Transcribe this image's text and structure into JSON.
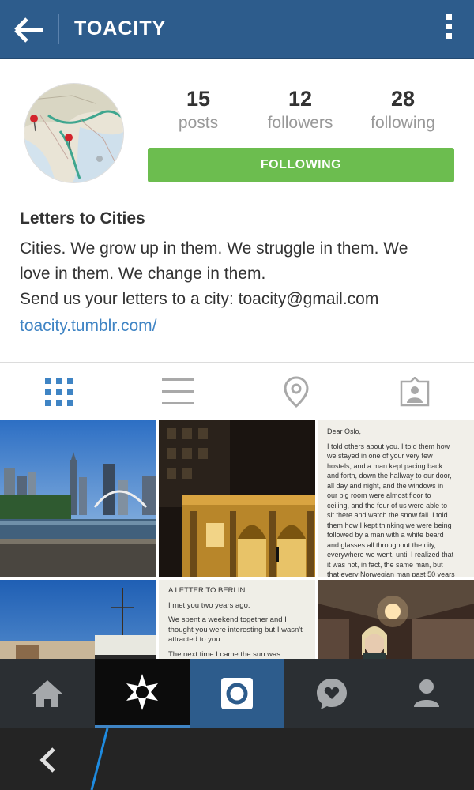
{
  "header": {
    "title": "TOACITY"
  },
  "profile": {
    "stats": [
      {
        "count": "15",
        "label": "posts"
      },
      {
        "count": "12",
        "label": "followers"
      },
      {
        "count": "28",
        "label": "following"
      }
    ],
    "follow_button_label": "FOLLOWING",
    "name": "Letters to Cities",
    "bio_lines": [
      "Cities. We grow up in them. We struggle in them. We",
      "love in them. We change in them.",
      "Send us your letters to a city: toacity@gmail.com"
    ],
    "website": "toacity.tumblr.com/"
  },
  "tabs": [
    {
      "name": "grid-view",
      "icon": "grid-icon",
      "active": true
    },
    {
      "name": "list-view",
      "icon": "list-icon",
      "active": false
    },
    {
      "name": "map-view",
      "icon": "location-pin-icon",
      "active": false
    },
    {
      "name": "tagged-view",
      "icon": "tagged-person-icon",
      "active": false
    }
  ],
  "posts": {
    "letter_oslo": [
      "Dear Oslo,",
      "",
      "I told others about you. I told them how",
      "we stayed in one of your very few",
      "hostels, and a man kept pacing back",
      "and forth, down the hallway to our door,",
      "all day and night, and the windows in",
      "our big room were almost floor to",
      "ceiling, and the four of us were able to",
      "sit there and watch the snow fall. I told",
      "them how I kept thinking we were being",
      "followed by a man with a white beard",
      "and glasses all throughout the city,",
      "everywhere we went, until I realized that",
      "it was not, in fact, the same man, but",
      "that every Norwegian man past 50 years"
    ],
    "letter_berlin": [
      "A LETTER TO BERLIN:",
      "",
      "I met you two years ago.",
      "",
      "We spent a weekend together and I",
      "thought you were interesting but I wasn't",
      "attracted to you.",
      "",
      "The next time I came the sun was"
    ]
  },
  "bottom_nav": [
    {
      "name": "home",
      "icon": "home-icon",
      "active": false
    },
    {
      "name": "explore",
      "icon": "explore-icon",
      "active": true
    },
    {
      "name": "camera",
      "icon": "camera-icon",
      "active": false
    },
    {
      "name": "activity",
      "icon": "activity-heart-icon",
      "active": false
    },
    {
      "name": "profile",
      "icon": "profile-icon",
      "active": false
    }
  ],
  "colors": {
    "header_bg": "#2d5c8c",
    "follow_green": "#6cbd4f",
    "link_blue": "#3f84c4",
    "active_tab_blue": "#3f84c4",
    "nav_bg": "#2b2f33",
    "camera_tab_bg": "#2d5c8c"
  }
}
